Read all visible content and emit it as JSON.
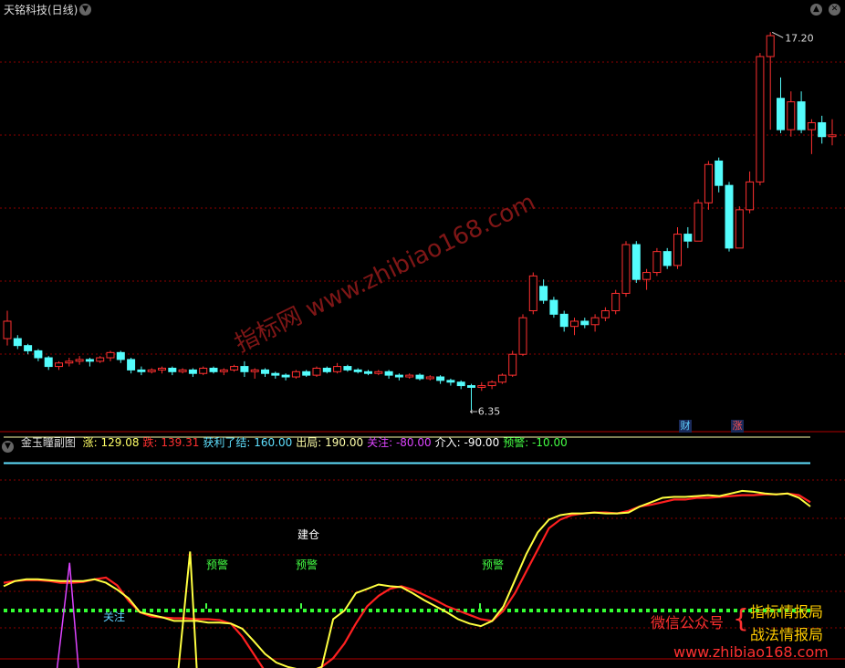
{
  "main_panel": {
    "title": "天铭科技(日线)",
    "high_label": "17.20",
    "low_label": "6.35",
    "badges": [
      {
        "text": "财",
        "color": "#5fd0ff"
      },
      {
        "text": "涨",
        "color": "#ff5050"
      }
    ]
  },
  "sub_panel": {
    "title": "金玉瞳副图",
    "params": [
      {
        "label": "涨:",
        "value": "129.08",
        "color": "#ffff66"
      },
      {
        "label": "跌:",
        "value": "139.31",
        "color": "#ff3030"
      },
      {
        "label": "获利了结:",
        "value": "160.00",
        "color": "#5fe0ff"
      },
      {
        "label": "出局:",
        "value": "190.00",
        "color": "#ffffaa"
      },
      {
        "label": "关注:",
        "value": "-80.00",
        "color": "#dd44ff"
      },
      {
        "label": "介入:",
        "value": "-90.00",
        "color": "#ffffff"
      },
      {
        "label": "预警:",
        "value": "-10.00",
        "color": "#44ff44"
      }
    ],
    "annotations": {
      "jiancang": "建仓",
      "yujing": "预警",
      "guanzhu": "关注"
    }
  },
  "watermark": {
    "diagonal": "指标网 www.zhibiao168.com",
    "wechat_label": "微信公众号",
    "account_1": "指标情报局",
    "account_2": "战法情报局",
    "url": "www.zhibiao168.com"
  },
  "colors": {
    "up": "#ff3030",
    "down": "#54fcfc",
    "grid": "#8b0000"
  },
  "chart_data": {
    "type": "candlestick",
    "title": "天铭科技(日线)",
    "candles": [
      [
        8.4,
        8.9,
        8.2,
        9.2
      ],
      [
        8.4,
        8.2,
        8.1,
        8.5
      ],
      [
        8.2,
        8.05,
        7.95,
        8.25
      ],
      [
        8.05,
        7.85,
        7.75,
        8.1
      ],
      [
        7.85,
        7.6,
        7.5,
        7.9
      ],
      [
        7.6,
        7.7,
        7.5,
        7.75
      ],
      [
        7.7,
        7.75,
        7.6,
        7.85
      ],
      [
        7.75,
        7.8,
        7.65,
        7.9
      ],
      [
        7.8,
        7.75,
        7.6,
        7.85
      ],
      [
        7.75,
        7.85,
        7.7,
        7.9
      ],
      [
        7.85,
        8.0,
        7.75,
        8.05
      ],
      [
        8.0,
        7.8,
        7.7,
        8.05
      ],
      [
        7.8,
        7.5,
        7.4,
        7.85
      ],
      [
        7.5,
        7.45,
        7.35,
        7.6
      ],
      [
        7.45,
        7.5,
        7.4,
        7.55
      ],
      [
        7.5,
        7.55,
        7.4,
        7.6
      ],
      [
        7.55,
        7.45,
        7.35,
        7.6
      ],
      [
        7.45,
        7.5,
        7.4,
        7.55
      ],
      [
        7.5,
        7.4,
        7.3,
        7.55
      ],
      [
        7.4,
        7.55,
        7.35,
        7.6
      ],
      [
        7.55,
        7.45,
        7.4,
        7.6
      ],
      [
        7.45,
        7.5,
        7.35,
        7.55
      ],
      [
        7.5,
        7.6,
        7.45,
        7.65
      ],
      [
        7.6,
        7.45,
        7.3,
        7.75
      ],
      [
        7.45,
        7.5,
        7.25,
        7.55
      ],
      [
        7.5,
        7.4,
        7.3,
        7.55
      ],
      [
        7.4,
        7.35,
        7.25,
        7.45
      ],
      [
        7.35,
        7.3,
        7.2,
        7.4
      ],
      [
        7.3,
        7.45,
        7.25,
        7.5
      ],
      [
        7.45,
        7.35,
        7.3,
        7.5
      ],
      [
        7.35,
        7.55,
        7.3,
        7.6
      ],
      [
        7.55,
        7.45,
        7.4,
        7.6
      ],
      [
        7.45,
        7.6,
        7.4,
        7.7
      ],
      [
        7.6,
        7.5,
        7.45,
        7.65
      ],
      [
        7.5,
        7.45,
        7.4,
        7.55
      ],
      [
        7.45,
        7.4,
        7.35,
        7.5
      ],
      [
        7.4,
        7.45,
        7.35,
        7.5
      ],
      [
        7.45,
        7.35,
        7.25,
        7.5
      ],
      [
        7.35,
        7.3,
        7.2,
        7.4
      ],
      [
        7.3,
        7.35,
        7.25,
        7.4
      ],
      [
        7.35,
        7.25,
        7.2,
        7.4
      ],
      [
        7.25,
        7.3,
        7.2,
        7.35
      ],
      [
        7.3,
        7.2,
        7.1,
        7.35
      ],
      [
        7.2,
        7.15,
        7.05,
        7.25
      ],
      [
        7.15,
        7.05,
        6.95,
        7.2
      ],
      [
        7.05,
        7.0,
        6.35,
        7.1
      ],
      [
        7.0,
        7.05,
        6.9,
        7.15
      ],
      [
        7.05,
        7.15,
        6.95,
        7.2
      ],
      [
        7.15,
        7.35,
        7.1,
        7.4
      ],
      [
        7.35,
        7.95,
        7.3,
        8.05
      ],
      [
        7.95,
        9.0,
        7.9,
        9.1
      ],
      [
        9.2,
        10.2,
        9.1,
        10.3
      ],
      [
        9.9,
        9.5,
        9.4,
        10.1
      ],
      [
        9.5,
        9.1,
        9.0,
        9.6
      ],
      [
        9.1,
        8.75,
        8.6,
        9.2
      ],
      [
        8.75,
        8.9,
        8.5,
        9.0
      ],
      [
        8.9,
        8.8,
        8.7,
        9.0
      ],
      [
        8.8,
        9.0,
        8.6,
        9.1
      ],
      [
        9.0,
        9.2,
        8.9,
        9.3
      ],
      [
        9.2,
        9.7,
        9.1,
        9.8
      ],
      [
        9.7,
        11.1,
        9.6,
        11.2
      ],
      [
        11.1,
        10.1,
        10.0,
        11.2
      ],
      [
        10.1,
        10.3,
        9.8,
        10.4
      ],
      [
        10.3,
        10.9,
        10.2,
        11.0
      ],
      [
        10.9,
        10.5,
        10.4,
        11.0
      ],
      [
        10.5,
        11.4,
        10.4,
        11.6
      ],
      [
        11.4,
        11.2,
        11.0,
        11.6
      ],
      [
        11.2,
        12.3,
        11.2,
        12.4
      ],
      [
        12.3,
        13.4,
        12.1,
        13.5
      ],
      [
        13.5,
        12.8,
        12.6,
        13.6
      ],
      [
        12.8,
        11.0,
        10.9,
        12.9
      ],
      [
        11.0,
        12.1,
        11.0,
        12.2
      ],
      [
        12.1,
        12.9,
        12.0,
        13.2
      ],
      [
        12.9,
        16.5,
        12.8,
        16.6
      ],
      [
        16.5,
        17.1,
        14.4,
        17.2
      ],
      [
        15.3,
        14.4,
        14.3,
        15.9
      ],
      [
        14.4,
        15.2,
        14.2,
        15.5
      ],
      [
        15.2,
        14.4,
        14.3,
        15.5
      ],
      [
        14.4,
        14.6,
        13.7,
        14.7
      ],
      [
        14.6,
        14.2,
        14.0,
        14.8
      ],
      [
        14.2,
        14.25,
        13.95,
        14.7
      ]
    ],
    "indicator": {
      "yellow": [
        18,
        24,
        26,
        26,
        25,
        24,
        24,
        24,
        26,
        22,
        14,
        4,
        -12,
        -15,
        -18,
        -22,
        -22,
        -22,
        -24,
        -24,
        -25,
        -31,
        -45,
        -60,
        -70,
        -75,
        -78,
        -80,
        -75,
        -20,
        -10,
        10,
        15,
        20,
        18,
        17,
        10,
        2,
        -5,
        -12,
        -20,
        -25,
        -28,
        -22,
        -5,
        25,
        55,
        80,
        95,
        100,
        102,
        102,
        103,
        102,
        102,
        103,
        110,
        115,
        120,
        121,
        121,
        122,
        123,
        122,
        125,
        128,
        127,
        125,
        124,
        125,
        120,
        110
      ],
      "red": [
        22,
        24,
        25,
        25,
        24,
        22,
        22,
        23,
        26,
        28,
        19,
        1,
        -12,
        -17,
        -18,
        -19,
        -19,
        -20,
        -20,
        -21,
        -25,
        -40,
        -60,
        -80,
        -88,
        -90,
        -84,
        -80,
        -75,
        -65,
        -48,
        -25,
        -5,
        7,
        15,
        18,
        14,
        8,
        2,
        -5,
        -10,
        -15,
        -20,
        -22,
        -10,
        10,
        35,
        60,
        85,
        95,
        100,
        102,
        103,
        103,
        102,
        105,
        110,
        112,
        115,
        118,
        118,
        120,
        120,
        121,
        122,
        123,
        123,
        124,
        124,
        125,
        123,
        115
      ],
      "guanzhu_spike_index": 5,
      "jiancang_spike_index": 14,
      "yujing_indices": [
        10,
        23
      ]
    }
  }
}
